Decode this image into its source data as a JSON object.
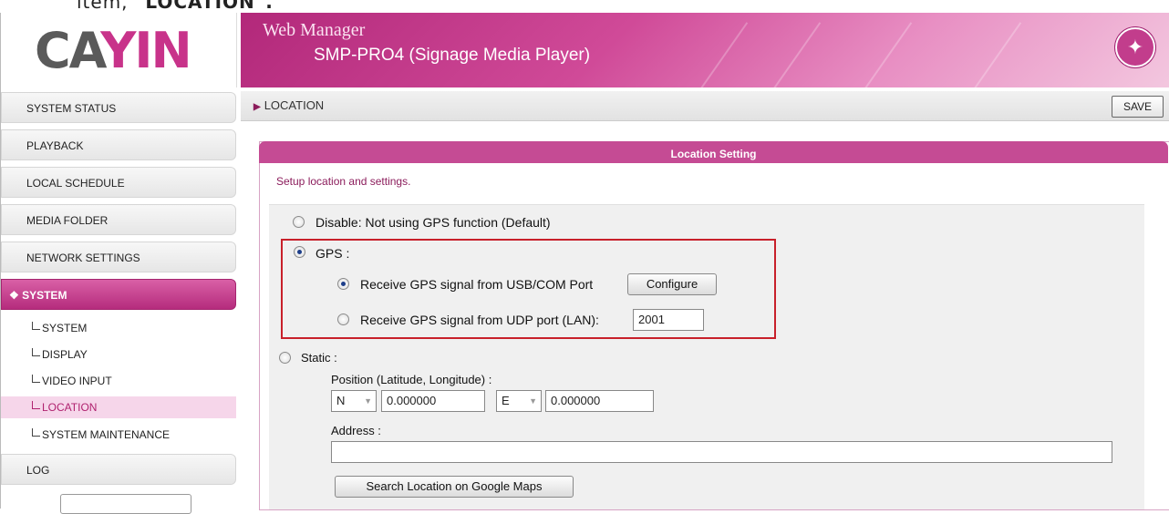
{
  "caption": {
    "prefix": "item, ",
    "bold": "\"LOCATION\"."
  },
  "logo": {
    "part1": "CA",
    "part2": "YIN",
    "accent": "#c8338a"
  },
  "header": {
    "title": "Web Manager",
    "subtitle": "SMP-PRO4 (Signage Media Player)",
    "icon": "magic-wand-icon"
  },
  "sidebar": {
    "items": [
      {
        "label": "SYSTEM STATUS"
      },
      {
        "label": "PLAYBACK"
      },
      {
        "label": "LOCAL SCHEDULE"
      },
      {
        "label": "MEDIA FOLDER"
      },
      {
        "label": "NETWORK SETTINGS"
      },
      {
        "label": "SYSTEM",
        "active": true
      },
      {
        "label": "LOG"
      }
    ],
    "sub_items": [
      {
        "label": "SYSTEM"
      },
      {
        "label": "DISPLAY"
      },
      {
        "label": "VIDEO INPUT"
      },
      {
        "label": "LOCATION",
        "selected": true
      },
      {
        "label": "SYSTEM MAINTENANCE"
      }
    ]
  },
  "breadcrumb": {
    "label": "LOCATION"
  },
  "toolbar": {
    "save_label": "SAVE"
  },
  "panel": {
    "title": "Location Setting",
    "description": "Setup location and settings.",
    "options": {
      "disable": "Disable: Not using GPS function (Default)",
      "gps": "GPS :",
      "gps_usb": "Receive GPS signal from USB/COM Port",
      "configure": "Configure",
      "gps_udp": "Receive GPS signal from UDP port (LAN):",
      "udp_port": "2001",
      "static": "Static :",
      "position_label": "Position (Latitude, Longitude) :",
      "lat_dir": "N",
      "lat_value": "0.000000",
      "lon_dir": "E",
      "lon_value": "0.000000",
      "address_label": "Address :",
      "address_value": "",
      "search_button": "Search Location on Google Maps"
    },
    "selected": "gps",
    "gps_selected": "usb"
  },
  "colors": {
    "accent": "#c54b94",
    "highlight": "#c8202a"
  }
}
